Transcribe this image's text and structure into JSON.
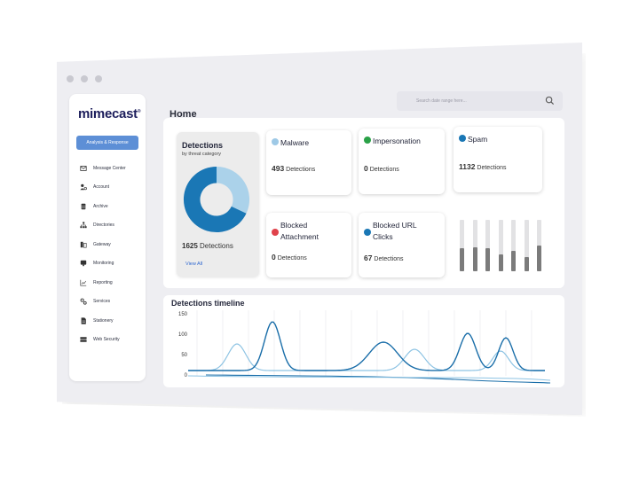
{
  "sidebar": {
    "brand": "mimecast",
    "primary_item": "Analysis & Response",
    "items": [
      {
        "label": "Message Center",
        "icon": "envelope-icon"
      },
      {
        "label": "Account",
        "icon": "user-gear-icon"
      },
      {
        "label": "Archive",
        "icon": "database-icon"
      },
      {
        "label": "Directories",
        "icon": "org-chart-icon"
      },
      {
        "label": "Gateway",
        "icon": "gateway-icon"
      },
      {
        "label": "Monitoring",
        "icon": "monitor-icon"
      },
      {
        "label": "Reporting",
        "icon": "line-chart-icon"
      },
      {
        "label": "Services",
        "icon": "gears-icon"
      },
      {
        "label": "Stationery",
        "icon": "document-icon"
      },
      {
        "label": "Web Security",
        "icon": "server-icon"
      }
    ]
  },
  "header": {
    "title": "Home",
    "search_placeholder": "Search date range here..."
  },
  "detections": {
    "title": "Detections",
    "subtitle": "by threat category",
    "count": "1625",
    "count_suffix": "Detections",
    "view_all": "View All",
    "donut": [
      {
        "value": 0.32,
        "color": "#abd2ea"
      },
      {
        "value": 0.68,
        "color": "#1a77b5"
      }
    ]
  },
  "cards": [
    {
      "title": "Malware",
      "count": "493",
      "suffix": "Detections",
      "icon_color": "#9ec9e6"
    },
    {
      "title": "Impersonation",
      "count": "0",
      "suffix": "Detections",
      "icon_color": "#2aa147"
    },
    {
      "title": "Spam",
      "count": "1132",
      "suffix": "Detections",
      "icon_color": "#1a77b5"
    },
    {
      "title": "Blocked Attachment",
      "count": "0",
      "suffix": "Detections",
      "icon_color": "#e0424b"
    },
    {
      "title": "Blocked URL Clicks",
      "count": "67",
      "suffix": "Detections",
      "icon_color": "#1a77b5"
    }
  ],
  "mini_bars": [
    0.45,
    0.47,
    0.44,
    0.32,
    0.4,
    0.28,
    0.5
  ],
  "timeline": {
    "title": "Detections timeline",
    "y_ticks": [
      "150",
      "100",
      "50",
      "0"
    ],
    "colors": {
      "series_a": "#1a6ea9",
      "series_b": "#8dc3e3"
    }
  }
}
